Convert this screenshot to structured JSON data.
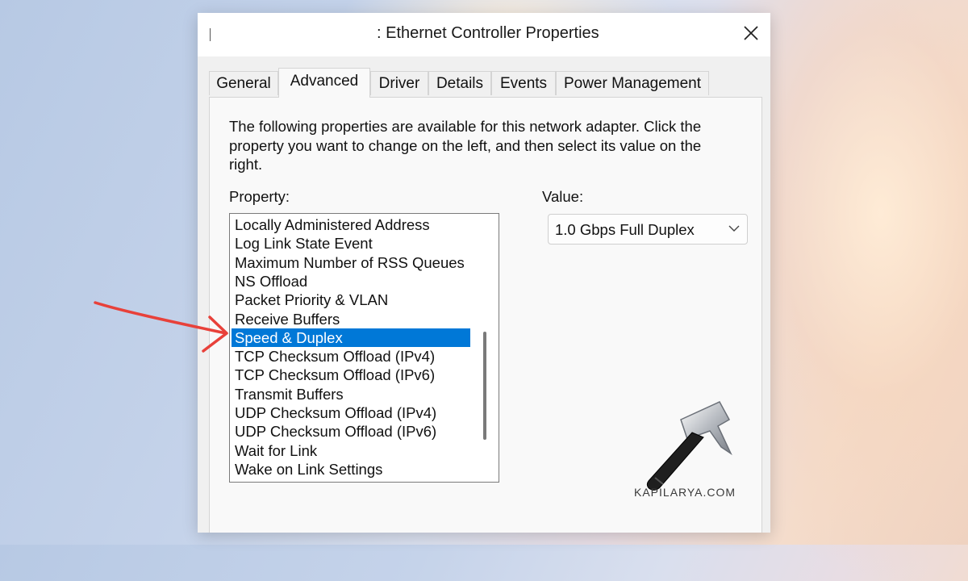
{
  "window": {
    "title": ": Ethernet Controller Properties"
  },
  "tabs": [
    {
      "label": "General"
    },
    {
      "label": "Advanced",
      "active": true
    },
    {
      "label": "Driver"
    },
    {
      "label": "Details"
    },
    {
      "label": "Events"
    },
    {
      "label": "Power Management"
    }
  ],
  "advanced": {
    "description": "The following properties are available for this network adapter. Click the property you want to change on the left, and then select its value on the right.",
    "property_label": "Property:",
    "value_label": "Value:",
    "properties": [
      "Locally Administered Address",
      "Log Link State Event",
      "Maximum Number of RSS Queues",
      "NS Offload",
      "Packet Priority & VLAN",
      "Receive Buffers",
      "Speed & Duplex",
      "TCP Checksum Offload (IPv4)",
      "TCP Checksum Offload (IPv6)",
      "Transmit Buffers",
      "UDP Checksum Offload (IPv4)",
      "UDP Checksum Offload (IPv6)",
      "Wait for Link",
      "Wake on Link Settings"
    ],
    "selected_property": "Speed & Duplex",
    "value_selected": "1.0 Gbps Full Duplex"
  },
  "watermark": {
    "text": "KAPILARYA.COM"
  },
  "colors": {
    "selection": "#0078d7",
    "annotation_arrow": "#e8413a"
  },
  "icons": [
    "close-icon",
    "chevron-down-icon",
    "hammer-icon",
    "red-arrow-icon"
  ]
}
